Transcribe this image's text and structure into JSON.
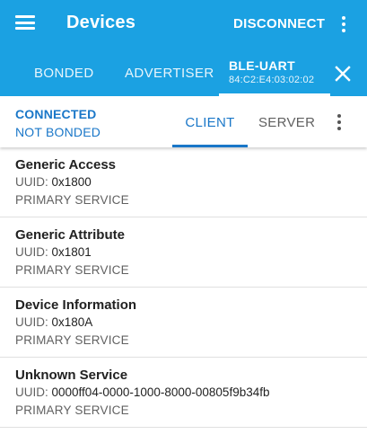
{
  "app_bar": {
    "title": "Devices",
    "disconnect_label": "DISCONNECT",
    "menu_icon": "hamburger-menu-icon",
    "overflow_icon": "more-vert-icon",
    "background_color": "#1ba1e2"
  },
  "device_tabs": {
    "bonded_label": "BONDED",
    "advertiser_label": "ADVERTISER",
    "active_device": {
      "name": "BLE-UART",
      "address": "84:C2:E4:03:02:02"
    },
    "close_icon": "close-icon"
  },
  "connection": {
    "status": "CONNECTED",
    "bond_state": "NOT BONDED",
    "accent_color": "#1a77c8",
    "tabs": {
      "client_label": "CLIENT",
      "server_label": "SERVER",
      "selected": "CLIENT"
    },
    "overflow_icon": "more-vert-icon"
  },
  "services": [
    {
      "name": "Generic Access",
      "uuid_label": "UUID:",
      "uuid": "0x1800",
      "type": "PRIMARY SERVICE"
    },
    {
      "name": "Generic Attribute",
      "uuid_label": "UUID:",
      "uuid": "0x1801",
      "type": "PRIMARY SERVICE"
    },
    {
      "name": "Device Information",
      "uuid_label": "UUID:",
      "uuid": "0x180A",
      "type": "PRIMARY SERVICE"
    },
    {
      "name": "Unknown Service",
      "uuid_label": "UUID:",
      "uuid": "0000ff04-0000-1000-8000-00805f9b34fb",
      "type": "PRIMARY SERVICE"
    }
  ]
}
